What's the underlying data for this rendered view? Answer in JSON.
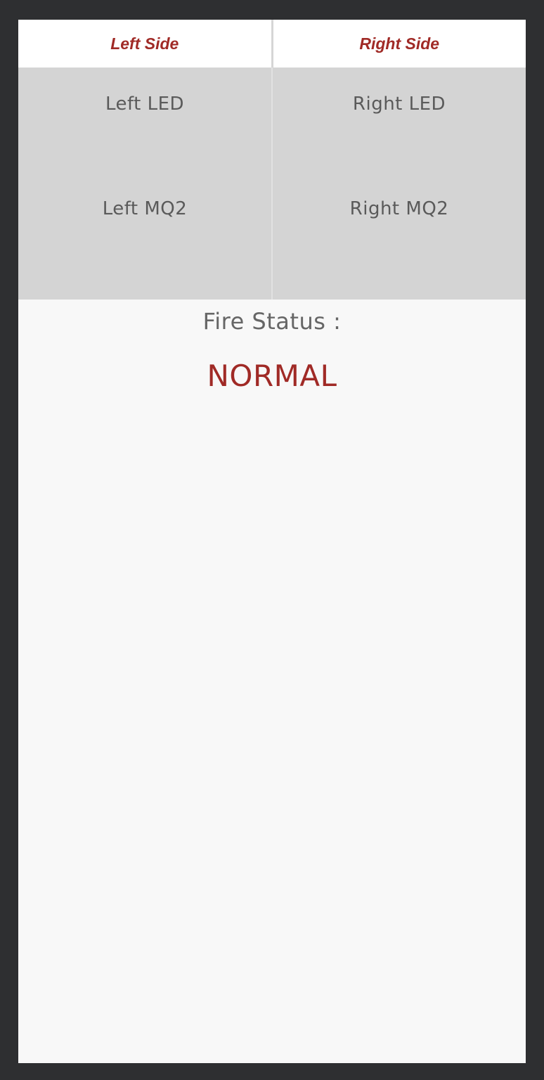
{
  "tabs": [
    {
      "label": "Left Side"
    },
    {
      "label": "Right Side"
    }
  ],
  "grid": {
    "left": {
      "led_label": "Left LED",
      "mq2_label": "Left MQ2"
    },
    "right": {
      "led_label": "Right LED",
      "mq2_label": "Right MQ2"
    }
  },
  "status": {
    "title": "Fire Status :",
    "value": "NORMAL"
  },
  "colors": {
    "accent": "#a02a26",
    "frame": "#2e2f31",
    "panel": "#d4d4d4",
    "background": "#f8f8f8"
  }
}
